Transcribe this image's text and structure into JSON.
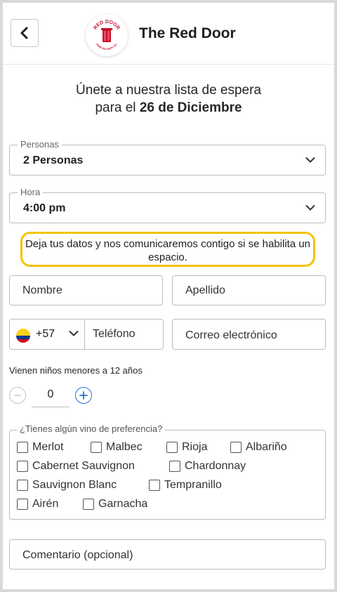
{
  "header": {
    "back_icon": "chevron-left-icon",
    "logo_text_top": "RED DOOR",
    "logo_text_bottom": "WINE DELIVERY CO.",
    "brand": "The Red Door"
  },
  "headline": {
    "line1": "Únete a nuestra lista de espera",
    "line2_prefix": "para el ",
    "line2_date": "26 de Diciembre"
  },
  "party": {
    "legend": "Personas",
    "value": "2 Personas"
  },
  "time": {
    "legend": "Hora",
    "value": "4:00 pm"
  },
  "notice": "Deja tus datos y nos comunicaremos contigo si se habilita un espacio.",
  "form": {
    "first_name": "Nombre",
    "last_name": "Apellido",
    "dial_code": "+57",
    "phone": "Teléfono",
    "email": "Correo electrónico"
  },
  "kids": {
    "label": "Vienen niños menores a 12 años",
    "value": "0"
  },
  "wines": {
    "legend": "¿Tienes algún vino de preferencia?",
    "options": [
      "Merlot",
      "Malbec",
      "Rioja",
      "Albariño",
      "Cabernet Sauvignon",
      "Chardonnay",
      "Sauvignon Blanc",
      "Tempranillo",
      "Airén",
      "Garnacha"
    ]
  },
  "comment": "Comentario (opcional)",
  "colors": {
    "notice_border": "#f3c300",
    "accent": "#2a70d6",
    "logo_red": "#c8102e"
  }
}
